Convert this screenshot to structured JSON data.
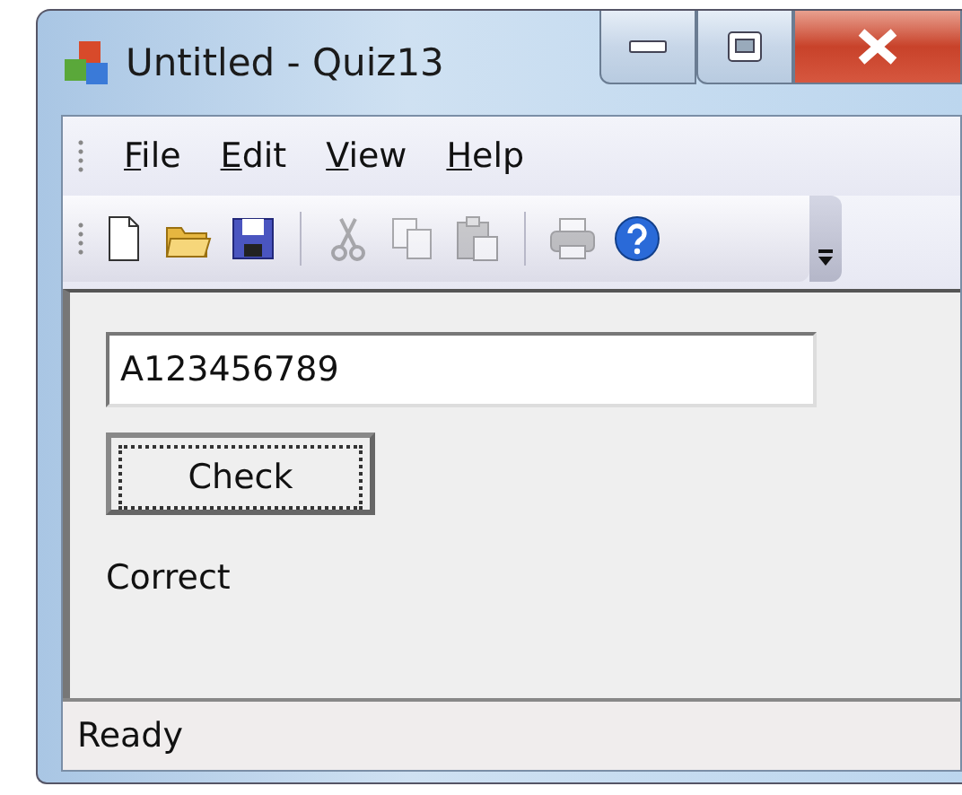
{
  "window": {
    "title": "Untitled - Quiz13"
  },
  "menu": [
    {
      "label": "File"
    },
    {
      "label": "Edit"
    },
    {
      "label": "View"
    },
    {
      "label": "Help"
    }
  ],
  "toolbar": [
    {
      "kind": "new",
      "disabled": false
    },
    {
      "kind": "open",
      "disabled": false
    },
    {
      "kind": "save",
      "disabled": false
    },
    {
      "kind": "separator"
    },
    {
      "kind": "cut",
      "disabled": true
    },
    {
      "kind": "copy",
      "disabled": true
    },
    {
      "kind": "paste",
      "disabled": true
    },
    {
      "kind": "separator"
    },
    {
      "kind": "print",
      "disabled": true
    },
    {
      "kind": "help",
      "disabled": false
    }
  ],
  "answer": {
    "value": "A123456789"
  },
  "check_button": {
    "label": "Check",
    "focused": true
  },
  "result": "Correct",
  "status_bar": {
    "text": "Ready"
  }
}
